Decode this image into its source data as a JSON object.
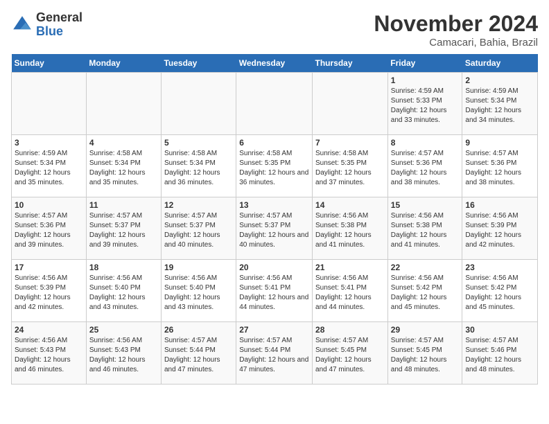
{
  "header": {
    "logo_general": "General",
    "logo_blue": "Blue",
    "month_title": "November 2024",
    "location": "Camacari, Bahia, Brazil"
  },
  "days_of_week": [
    "Sunday",
    "Monday",
    "Tuesday",
    "Wednesday",
    "Thursday",
    "Friday",
    "Saturday"
  ],
  "weeks": [
    [
      {
        "day": "",
        "info": ""
      },
      {
        "day": "",
        "info": ""
      },
      {
        "day": "",
        "info": ""
      },
      {
        "day": "",
        "info": ""
      },
      {
        "day": "",
        "info": ""
      },
      {
        "day": "1",
        "info": "Sunrise: 4:59 AM\nSunset: 5:33 PM\nDaylight: 12 hours and 33 minutes."
      },
      {
        "day": "2",
        "info": "Sunrise: 4:59 AM\nSunset: 5:34 PM\nDaylight: 12 hours and 34 minutes."
      }
    ],
    [
      {
        "day": "3",
        "info": "Sunrise: 4:59 AM\nSunset: 5:34 PM\nDaylight: 12 hours and 35 minutes."
      },
      {
        "day": "4",
        "info": "Sunrise: 4:58 AM\nSunset: 5:34 PM\nDaylight: 12 hours and 35 minutes."
      },
      {
        "day": "5",
        "info": "Sunrise: 4:58 AM\nSunset: 5:34 PM\nDaylight: 12 hours and 36 minutes."
      },
      {
        "day": "6",
        "info": "Sunrise: 4:58 AM\nSunset: 5:35 PM\nDaylight: 12 hours and 36 minutes."
      },
      {
        "day": "7",
        "info": "Sunrise: 4:58 AM\nSunset: 5:35 PM\nDaylight: 12 hours and 37 minutes."
      },
      {
        "day": "8",
        "info": "Sunrise: 4:57 AM\nSunset: 5:36 PM\nDaylight: 12 hours and 38 minutes."
      },
      {
        "day": "9",
        "info": "Sunrise: 4:57 AM\nSunset: 5:36 PM\nDaylight: 12 hours and 38 minutes."
      }
    ],
    [
      {
        "day": "10",
        "info": "Sunrise: 4:57 AM\nSunset: 5:36 PM\nDaylight: 12 hours and 39 minutes."
      },
      {
        "day": "11",
        "info": "Sunrise: 4:57 AM\nSunset: 5:37 PM\nDaylight: 12 hours and 39 minutes."
      },
      {
        "day": "12",
        "info": "Sunrise: 4:57 AM\nSunset: 5:37 PM\nDaylight: 12 hours and 40 minutes."
      },
      {
        "day": "13",
        "info": "Sunrise: 4:57 AM\nSunset: 5:37 PM\nDaylight: 12 hours and 40 minutes."
      },
      {
        "day": "14",
        "info": "Sunrise: 4:56 AM\nSunset: 5:38 PM\nDaylight: 12 hours and 41 minutes."
      },
      {
        "day": "15",
        "info": "Sunrise: 4:56 AM\nSunset: 5:38 PM\nDaylight: 12 hours and 41 minutes."
      },
      {
        "day": "16",
        "info": "Sunrise: 4:56 AM\nSunset: 5:39 PM\nDaylight: 12 hours and 42 minutes."
      }
    ],
    [
      {
        "day": "17",
        "info": "Sunrise: 4:56 AM\nSunset: 5:39 PM\nDaylight: 12 hours and 42 minutes."
      },
      {
        "day": "18",
        "info": "Sunrise: 4:56 AM\nSunset: 5:40 PM\nDaylight: 12 hours and 43 minutes."
      },
      {
        "day": "19",
        "info": "Sunrise: 4:56 AM\nSunset: 5:40 PM\nDaylight: 12 hours and 43 minutes."
      },
      {
        "day": "20",
        "info": "Sunrise: 4:56 AM\nSunset: 5:41 PM\nDaylight: 12 hours and 44 minutes."
      },
      {
        "day": "21",
        "info": "Sunrise: 4:56 AM\nSunset: 5:41 PM\nDaylight: 12 hours and 44 minutes."
      },
      {
        "day": "22",
        "info": "Sunrise: 4:56 AM\nSunset: 5:42 PM\nDaylight: 12 hours and 45 minutes."
      },
      {
        "day": "23",
        "info": "Sunrise: 4:56 AM\nSunset: 5:42 PM\nDaylight: 12 hours and 45 minutes."
      }
    ],
    [
      {
        "day": "24",
        "info": "Sunrise: 4:56 AM\nSunset: 5:43 PM\nDaylight: 12 hours and 46 minutes."
      },
      {
        "day": "25",
        "info": "Sunrise: 4:56 AM\nSunset: 5:43 PM\nDaylight: 12 hours and 46 minutes."
      },
      {
        "day": "26",
        "info": "Sunrise: 4:57 AM\nSunset: 5:44 PM\nDaylight: 12 hours and 47 minutes."
      },
      {
        "day": "27",
        "info": "Sunrise: 4:57 AM\nSunset: 5:44 PM\nDaylight: 12 hours and 47 minutes."
      },
      {
        "day": "28",
        "info": "Sunrise: 4:57 AM\nSunset: 5:45 PM\nDaylight: 12 hours and 47 minutes."
      },
      {
        "day": "29",
        "info": "Sunrise: 4:57 AM\nSunset: 5:45 PM\nDaylight: 12 hours and 48 minutes."
      },
      {
        "day": "30",
        "info": "Sunrise: 4:57 AM\nSunset: 5:46 PM\nDaylight: 12 hours and 48 minutes."
      }
    ]
  ]
}
